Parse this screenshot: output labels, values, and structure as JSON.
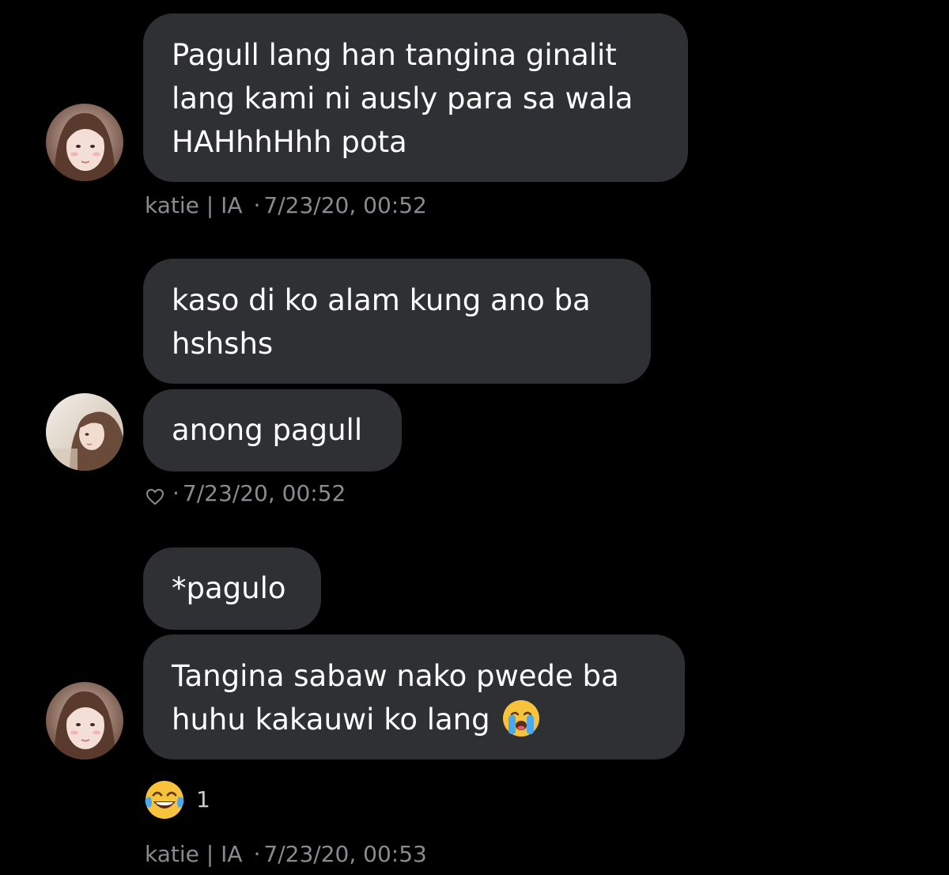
{
  "messages": [
    {
      "lines": [
        "Pagull lang han tangina ginalit",
        "lang kami ni ausly para sa wala",
        "HAHhhHhh pota"
      ]
    },
    {
      "lines": [
        "kaso di ko alam kung ano ba",
        "hshshs"
      ]
    },
    {
      "lines": [
        "anong pagull"
      ]
    },
    {
      "lines": [
        "*pagulo"
      ]
    },
    {
      "lines": [
        "Tangina sabaw nako pwede ba",
        "huhu kakauwi ko lang"
      ],
      "trailing_emoji": "loudly-crying-face"
    }
  ],
  "meta": {
    "group1": {
      "sender": "katie | IA",
      "separator": "·",
      "timestamp": "7/23/20, 00:52"
    },
    "group2": {
      "sender_icon": "heart-outline-icon",
      "separator": "·",
      "timestamp": "7/23/20, 00:52"
    },
    "group3": {
      "sender": "katie | IA",
      "separator": "·",
      "timestamp": "7/23/20, 00:53"
    }
  },
  "reaction": {
    "emoji": "face-with-tears-of-joy",
    "count": "1"
  },
  "colors": {
    "background": "#000000",
    "bubble": "#2f3033",
    "text": "#ffffff",
    "meta_text": "#8a8b8f"
  }
}
